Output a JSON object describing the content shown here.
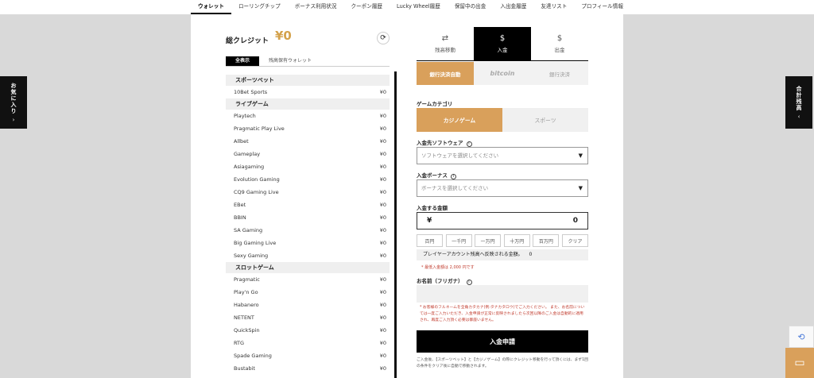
{
  "nav": {
    "items": [
      "ウォレット",
      "ローリングチップ",
      "ボーナス利用状況",
      "クーポン履歴",
      "Lucky Wheel履歴",
      "保留中の出金",
      "入出金履歴",
      "友達リスト",
      "プロフィール情報"
    ]
  },
  "side": {
    "left_label": "お気に入り",
    "left_arrow": "›",
    "right_label": "合計残高",
    "right_arrow": "‹"
  },
  "wallet": {
    "title": "総クレジット",
    "amount": "¥0",
    "tab_all": "全表示",
    "tab_held": "残高保有ウォレット",
    "sections": [
      {
        "title": "スポーツベット",
        "rows": [
          {
            "name": "10Bet Sports",
            "value": "¥0"
          }
        ]
      },
      {
        "title": "ライブゲーム",
        "rows": [
          {
            "name": "Playtech",
            "value": "¥0"
          },
          {
            "name": "Pragmatic Play Live",
            "value": "¥0"
          },
          {
            "name": "Allbet",
            "value": "¥0"
          },
          {
            "name": "Gameplay",
            "value": "¥0"
          },
          {
            "name": "Asiagaming",
            "value": "¥0"
          },
          {
            "name": "Evolution Gaming",
            "value": "¥0"
          },
          {
            "name": "CQ9 Gaming Live",
            "value": "¥0"
          },
          {
            "name": "EBet",
            "value": "¥0"
          },
          {
            "name": "BBIN",
            "value": "¥0"
          },
          {
            "name": "SA Gaming",
            "value": "¥0"
          },
          {
            "name": "Big Gaming Live",
            "value": "¥0"
          },
          {
            "name": "Sexy Gaming",
            "value": "¥0"
          }
        ]
      },
      {
        "title": "スロットゲーム",
        "rows": [
          {
            "name": "Pragmatic",
            "value": "¥0"
          },
          {
            "name": "Play'n Go",
            "value": "¥0"
          },
          {
            "name": "Habanero",
            "value": "¥0"
          },
          {
            "name": "NETENT",
            "value": "¥0"
          },
          {
            "name": "QuickSpin",
            "value": "¥0"
          },
          {
            "name": "RTG",
            "value": "¥0"
          },
          {
            "name": "Spade Gaming",
            "value": "¥0"
          },
          {
            "name": "Bustabit",
            "value": "¥0"
          }
        ]
      }
    ]
  },
  "deposit": {
    "tabs": [
      {
        "label": "残高移動",
        "icon": "⇄"
      },
      {
        "label": "入金",
        "icon": "$"
      },
      {
        "label": "出金",
        "icon": "$"
      }
    ],
    "methods": [
      "銀行決済自動",
      "bitcoin",
      "銀行決済"
    ],
    "game_category_label": "ゲームカテゴリ",
    "categories": [
      "カジノゲーム",
      "スポーツ"
    ],
    "software_label": "入金先ソフトウェア",
    "software_placeholder": "ソフトウェアを選択してください",
    "bonus_label": "入金ボーナス",
    "bonus_placeholder": "ボーナスを選択してください",
    "amount_label": "入金する金額",
    "currency": "¥",
    "amount_value": "0",
    "quick_amounts": [
      "百円",
      "一千円",
      "一万円",
      "十万円",
      "百万円",
      "クリア"
    ],
    "reflect_text": "プレイヤーアカウント残高へ反映される金額。",
    "reflect_value": "0",
    "min_note": "* 最低入金額は 2,000 円です",
    "name_label": "お名前（フリガナ）",
    "warning": "* お客様のフルネームを全角カタカナ(例:タナカタロウ)でご入力ください。 また、お名前については一度ご入力いただき、入金申請が正常に反映されましたら次回以降のご入金は自動的に適用され、再度ご入力頂く必要は御座いません。",
    "submit": "入金申請",
    "footnote": "ご入金後、【スポーツベット】と【カジノゲーム】の際にクレジット移動を行って頂くには、まず1回の条件をクリア後に自動で移動されます。"
  },
  "widgets": {
    "recaptcha_icon": "recaptcha-icon",
    "chat_icon": "chat-icon"
  }
}
